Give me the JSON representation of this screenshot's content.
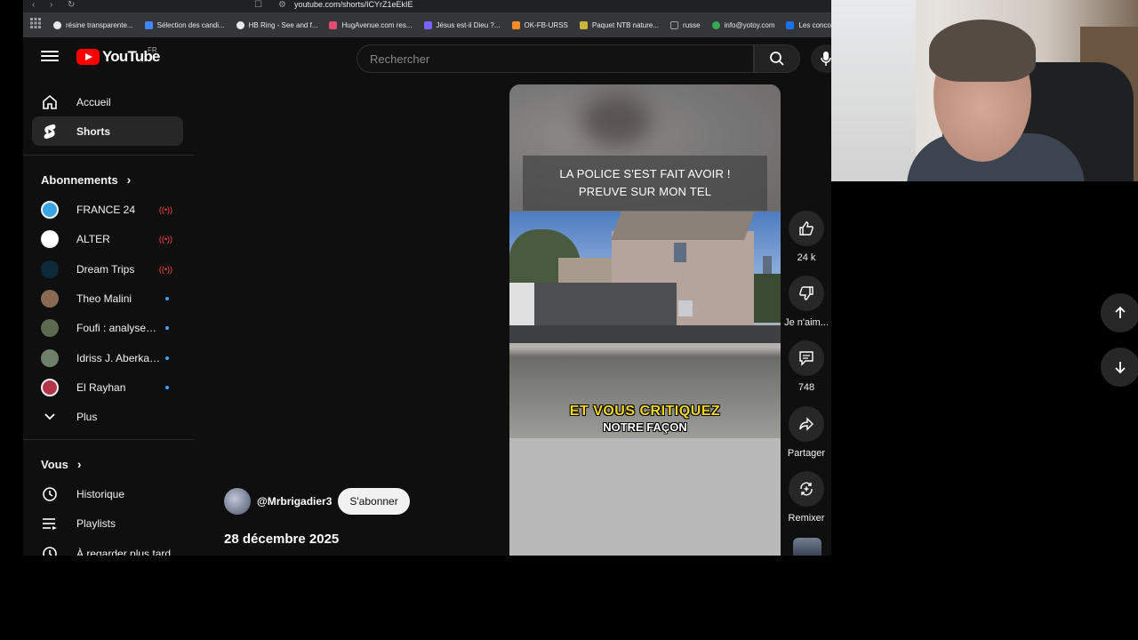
{
  "browser": {
    "url": "youtube.com/shorts/ICYrZ1eEkIE",
    "bookmarks": [
      {
        "label": "résine transparente...",
        "color": "#e8eaed"
      },
      {
        "label": "Sélection des candi...",
        "color": "#4285f4"
      },
      {
        "label": "HB Ring - See and f...",
        "color": "#e8eaed"
      },
      {
        "label": "HugAvenue.com res...",
        "color": "#e04d6e"
      },
      {
        "label": "Jésus est-il Dieu ?...",
        "color": "#7b61ff"
      },
      {
        "label": "OK-FB-URSS",
        "color": "#f28b2c"
      },
      {
        "label": "Paquet NTB nature...",
        "color": "#c8b43a"
      },
      {
        "label": "russe",
        "color": "#9aa0a6"
      },
      {
        "label": "info@yotoy.com",
        "color": "#34a853"
      },
      {
        "label": "Les concou",
        "color": "#1a73e8"
      }
    ]
  },
  "masthead": {
    "logo_text": "YouTube",
    "region": "FR",
    "search_placeholder": "Rechercher"
  },
  "sidebar": {
    "main": [
      {
        "label": "Accueil",
        "icon": "home-icon",
        "active": false
      },
      {
        "label": "Shorts",
        "icon": "shorts-icon",
        "active": true
      }
    ],
    "subscriptions_heading": "Abonnements",
    "subscriptions": [
      {
        "label": "FRANCE 24",
        "color": "#3aa3e0",
        "status": "live"
      },
      {
        "label": "ALTER",
        "color": "#ffffff",
        "status": "live"
      },
      {
        "label": "Dream Trips",
        "color": "#0d2a3a",
        "status": "live"
      },
      {
        "label": "Theo Malini",
        "color": "#8a6a52",
        "status": "new"
      },
      {
        "label": "Foufi : analyses ...",
        "color": "#5d6a4f",
        "status": "new"
      },
      {
        "label": "Idriss J. Aberkane",
        "color": "#6e7f6a",
        "status": "new"
      },
      {
        "label": "El Rayhan",
        "color": "#b2344a",
        "status": "new"
      }
    ],
    "more_label": "Plus",
    "you_heading": "Vous",
    "you_items": [
      {
        "label": "Historique",
        "icon": "history-icon"
      },
      {
        "label": "Playlists",
        "icon": "playlists-icon"
      },
      {
        "label": "À regarder plus tard",
        "icon": "watch-later-icon"
      }
    ]
  },
  "short": {
    "caption_top": "LA POLICE S'EST FAIT AVOIR ! PREUVE SUR MON TEL",
    "subtitle_line1": "ET VOUS CRITIQUEZ",
    "subtitle_line2": "NOTRE FAÇON",
    "channel": "@Mrbrigadier3",
    "subscribe": "S'abonner",
    "date": "28 décembre 2025"
  },
  "actions": {
    "likes": "24 k",
    "dislike": "Je n'aim...",
    "comments": "748",
    "share": "Partager",
    "remix": "Remixer"
  }
}
